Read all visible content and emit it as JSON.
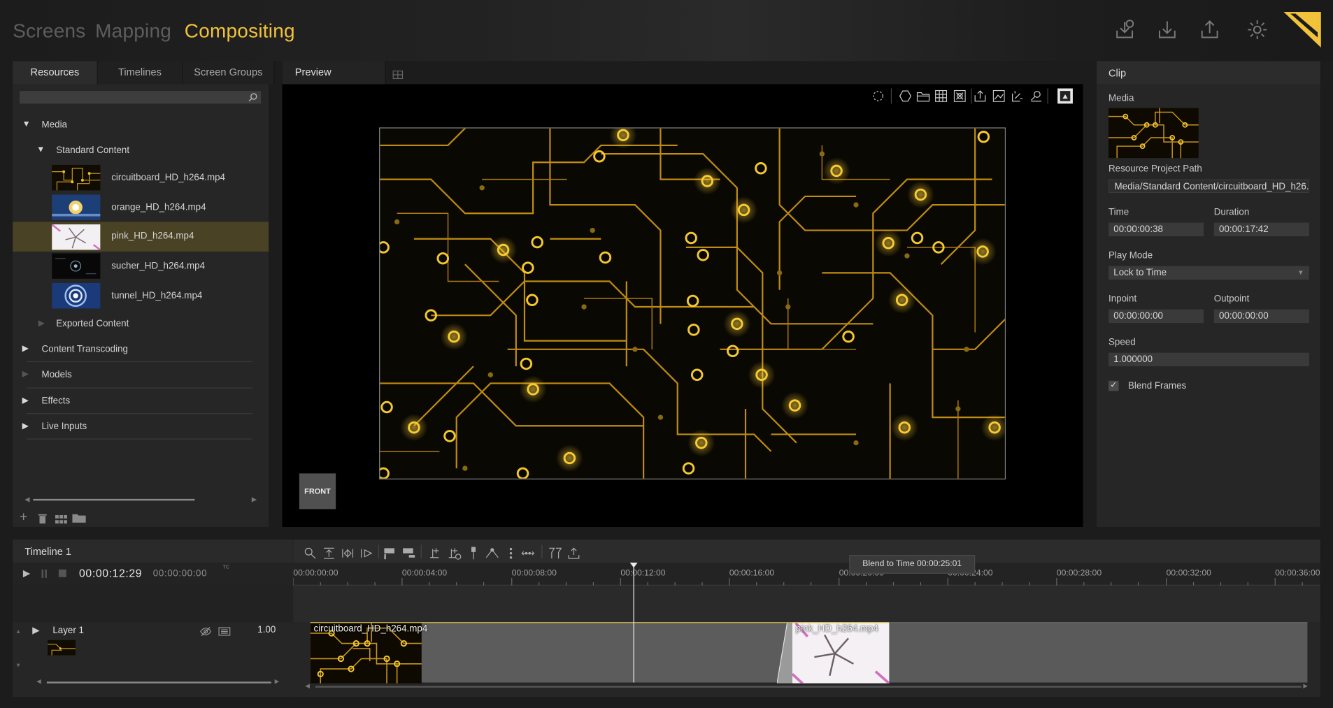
{
  "topbar": {
    "tabs": [
      {
        "label": "Screens",
        "active": false
      },
      {
        "label": "Mapping",
        "active": false
      },
      {
        "label": "Compositing",
        "active": true
      }
    ],
    "icons": [
      "download-history-icon",
      "download-icon",
      "upload-icon",
      "gear-icon"
    ],
    "logo": "brand-logo",
    "accent": "#f2c23a"
  },
  "resources": {
    "tabs": [
      "Resources",
      "Timelines",
      "Screen Groups"
    ],
    "search_placeholder": "",
    "tree": {
      "media": "Media",
      "standard_content": "Standard Content",
      "files": [
        {
          "name": "circuitboard_HD_h264.mp4",
          "selected": false
        },
        {
          "name": "orange_HD_h264.mp4",
          "selected": false
        },
        {
          "name": "pink_HD_h264.mp4",
          "selected": true
        },
        {
          "name": "sucher_HD_h264.mp4",
          "selected": false
        },
        {
          "name": "tunnel_HD_h264.mp4",
          "selected": false
        }
      ],
      "exported_content": "Exported Content",
      "sections": [
        "Content Transcoding",
        "Models",
        "Effects",
        "Live Inputs"
      ]
    },
    "footer_icons": [
      "add-icon",
      "trash-icon",
      "grid-icon",
      "folder-icon"
    ]
  },
  "preview": {
    "tab": "Preview",
    "front_label": "FRONT"
  },
  "clip": {
    "title": "Clip",
    "media_label": "Media",
    "resource_path_label": "Resource Project Path",
    "resource_path": "Media/Standard Content/circuitboard_HD_h26...",
    "time_label": "Time",
    "time": "00:00:00:38",
    "duration_label": "Duration",
    "duration": "00:00:17:42",
    "play_mode_label": "Play Mode",
    "play_mode": "Lock to Time",
    "inpoint_label": "Inpoint",
    "inpoint": "00:00:00:00",
    "outpoint_label": "Outpoint",
    "outpoint": "00:00:00:00",
    "speed_label": "Speed",
    "speed": "1.000000",
    "blend_label": "Blend Frames",
    "blend_checked": true
  },
  "timeline": {
    "title": "Timeline 1",
    "timecode": "00:00:12:29",
    "timecode2": "00:00:00:00",
    "tc_label": "TC",
    "tooltip": "Blend to Time 00:00:25:01",
    "ruler": [
      "00:00:00:00",
      "00:00:04:00",
      "00:00:08:00",
      "00:00:12:00",
      "00:00:16:00",
      "00:00:20:00",
      "00:00:24:00",
      "00:00:28:00",
      "00:00:32:00",
      "00:00:36:00"
    ],
    "layer": {
      "name": "Layer 1",
      "opacity": "1.00"
    },
    "clips": [
      {
        "name": "circuitboard_HD_h264.mp4"
      },
      {
        "name": "pink_HD_h264.mp4"
      }
    ]
  }
}
